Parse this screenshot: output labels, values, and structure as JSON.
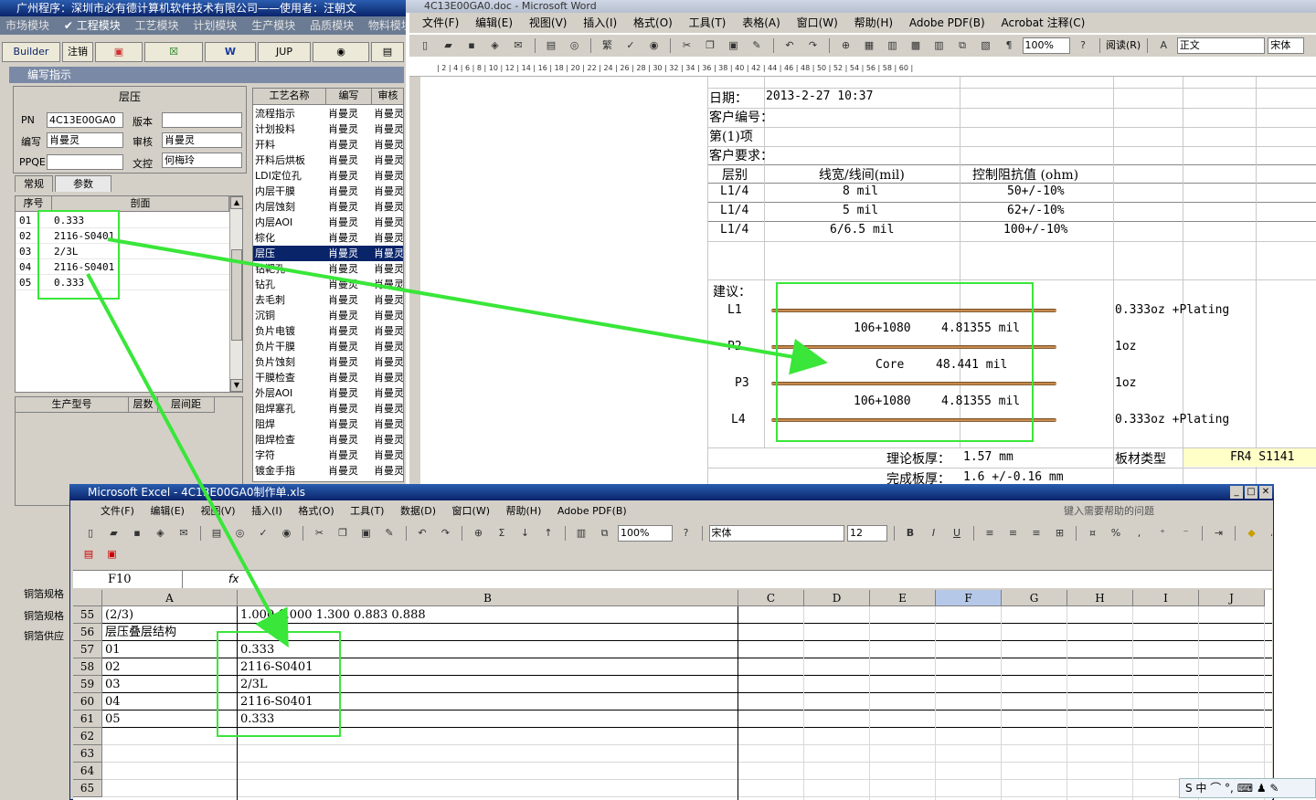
{
  "erp": {
    "title": "广州程序：深圳市必有德计算机软件技术有限公司——使用者：汪朝文",
    "modules": [
      "市场模块",
      "✔ 工程模块",
      "工艺模块",
      "计划模块",
      "生产模块",
      "品质模块",
      "物料模块"
    ],
    "toolbar": [
      "Builder",
      "注销",
      "JUP"
    ],
    "subtitle": "编写指示",
    "form": {
      "heading": "层压",
      "pn_label": "PN",
      "pn_value": "4C13E00GA0",
      "version_label": "版本",
      "version_value": "",
      "author_label": "编写",
      "author_value": "肖曼灵",
      "reviewer_label": "审核",
      "reviewer_value": "肖曼灵",
      "ppqe_label": "PPQE",
      "ppqe_value": "",
      "doc_label": "文控",
      "doc_value": "何梅玲"
    },
    "tabs": [
      "常规",
      "参数"
    ],
    "params": {
      "headers": [
        "序号",
        "剖面"
      ],
      "rows": [
        [
          "01",
          "0.333"
        ],
        [
          "02",
          "2116-S0401"
        ],
        [
          "03",
          "2/3L"
        ],
        [
          "04",
          "2116-S0401"
        ],
        [
          "05",
          "0.333"
        ]
      ]
    },
    "prod_headers": [
      "生产型号",
      "层数",
      "层间距"
    ],
    "copper_labels": [
      "铜箔规格",
      "铜箔规格",
      "铜箔供应"
    ],
    "process": {
      "headers": [
        "工艺名称",
        "编写",
        "审核"
      ],
      "rows": [
        [
          "流程指示",
          "肖曼灵",
          "肖曼灵"
        ],
        [
          "计划投料",
          "肖曼灵",
          "肖曼灵"
        ],
        [
          "开料",
          "肖曼灵",
          "肖曼灵"
        ],
        [
          "开料后烘板",
          "肖曼灵",
          "肖曼灵"
        ],
        [
          "LDI定位孔",
          "肖曼灵",
          "肖曼灵"
        ],
        [
          "内层干膜",
          "肖曼灵",
          "肖曼灵"
        ],
        [
          "内层蚀刻",
          "肖曼灵",
          "肖曼灵"
        ],
        [
          "内层AOI",
          "肖曼灵",
          "肖曼灵"
        ],
        [
          "棕化",
          "肖曼灵",
          "肖曼灵"
        ],
        [
          "层压",
          "肖曼灵",
          "肖曼灵"
        ],
        [
          "钻靶孔",
          "肖曼灵",
          "肖曼灵"
        ],
        [
          "钻孔",
          "肖曼灵",
          "肖曼灵"
        ],
        [
          "去毛刺",
          "肖曼灵",
          "肖曼灵"
        ],
        [
          "沉铜",
          "肖曼灵",
          "肖曼灵"
        ],
        [
          "负片电镀",
          "肖曼灵",
          "肖曼灵"
        ],
        [
          "负片干膜",
          "肖曼灵",
          "肖曼灵"
        ],
        [
          "负片蚀刻",
          "肖曼灵",
          "肖曼灵"
        ],
        [
          "干膜检查",
          "肖曼灵",
          "肖曼灵"
        ],
        [
          "外层AOI",
          "肖曼灵",
          "肖曼灵"
        ],
        [
          "阻焊塞孔",
          "肖曼灵",
          "肖曼灵"
        ],
        [
          "阻焊",
          "肖曼灵",
          "肖曼灵"
        ],
        [
          "阻焊检查",
          "肖曼灵",
          "肖曼灵"
        ],
        [
          "字符",
          "肖曼灵",
          "肖曼灵"
        ],
        [
          "镀金手指",
          "肖曼灵",
          "肖曼灵"
        ]
      ]
    }
  },
  "word": {
    "title": "4C13E00GA0.doc - Microsoft Word",
    "menu": [
      "文件(F)",
      "编辑(E)",
      "视图(V)",
      "插入(I)",
      "格式(O)",
      "工具(T)",
      "表格(A)",
      "窗口(W)",
      "帮助(H)",
      "Adobe PDF(B)",
      "Acrobat 注释(C)"
    ],
    "zoom": "100%",
    "read_label": "阅读(R)",
    "style": "正文",
    "font": "宋体",
    "date_label": "日期：",
    "date_value": "2013-2-27 10:37",
    "customer_no": "客户编号：",
    "item_no": "第(1)项",
    "customer_req": "客户要求：",
    "imp_headers": [
      "层别",
      "线宽/线间(mil)",
      "控制阻抗值 (ohm)"
    ],
    "imp_rows": [
      [
        "L1/4",
        "8 mil",
        "50+/-10%"
      ],
      [
        "L1/4",
        "5 mil",
        "62+/-10%"
      ],
      [
        "L1/4",
        "6/6.5 mil",
        "100+/-10%"
      ]
    ],
    "suggest": "建议：",
    "stack": {
      "layers": [
        "L1",
        "P2",
        "P3",
        "L4"
      ],
      "pp1": "106+1080",
      "pp1_thk": "4.81355 mil",
      "core": "Core",
      "core_thk": "48.441 mil",
      "pp2": "106+1080",
      "pp2_thk": "4.81355 mil",
      "cu_L1": "0.333oz +Plating",
      "cu_P2": "1oz",
      "cu_P3": "1oz",
      "cu_L4": "0.333oz +Plating"
    },
    "theory_label": "理论板厚：",
    "theory_value": "1.57 mm",
    "material_label": "板材类型",
    "material_value": "FR4 S1141",
    "finish_label": "完成板厚：",
    "finish_value": "1.6 +/-0.16 mm"
  },
  "excel": {
    "title": "Microsoft Excel - 4C13E00GA0制作单.xls",
    "menu": [
      "文件(F)",
      "编辑(E)",
      "视图(V)",
      "插入(I)",
      "格式(O)",
      "工具(T)",
      "数据(D)",
      "窗口(W)",
      "帮助(H)",
      "Adobe PDF(B)"
    ],
    "help_placeholder": "键入需要帮助的问题",
    "zoom": "100%",
    "font": "宋体",
    "size": "12",
    "name_box": "F10",
    "fx": "fx",
    "columns": [
      "A",
      "B",
      "C",
      "D",
      "E",
      "F",
      "G",
      "H",
      "I",
      "J"
    ],
    "rows": [
      {
        "num": "55",
        "a": "(2/3)",
        "b": "1.000   1.000   1.300              0.883   0.888"
      },
      {
        "num": "56",
        "a": "层压叠层结构",
        "b": ""
      },
      {
        "num": "57",
        "a": "01",
        "b": "0.333"
      },
      {
        "num": "58",
        "a": "02",
        "b": "2116-S0401"
      },
      {
        "num": "59",
        "a": "03",
        "b": "2/3L"
      },
      {
        "num": "60",
        "a": "04",
        "b": "2116-S0401"
      },
      {
        "num": "61",
        "a": "05",
        "b": "0.333"
      },
      {
        "num": "62",
        "a": "",
        "b": ""
      },
      {
        "num": "63",
        "a": "",
        "b": ""
      },
      {
        "num": "64",
        "a": "",
        "b": ""
      },
      {
        "num": "65",
        "a": "",
        "b": ""
      }
    ]
  },
  "tray": "S 中 ⌒ °, ⌨ ♟ ✎"
}
